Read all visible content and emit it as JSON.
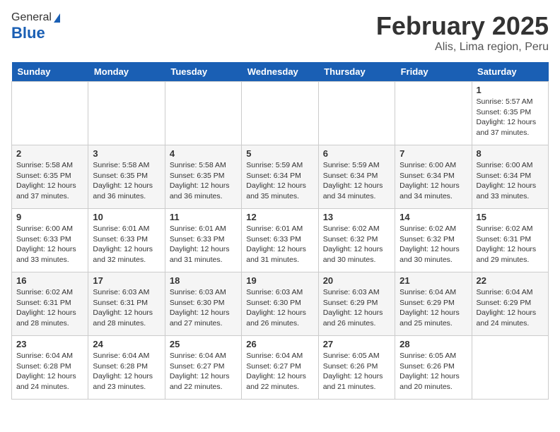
{
  "header": {
    "logo_general": "General",
    "logo_blue": "Blue",
    "title": "February 2025",
    "subtitle": "Alis, Lima region, Peru"
  },
  "days_of_week": [
    "Sunday",
    "Monday",
    "Tuesday",
    "Wednesday",
    "Thursday",
    "Friday",
    "Saturday"
  ],
  "weeks": [
    [
      {
        "day": "",
        "info": ""
      },
      {
        "day": "",
        "info": ""
      },
      {
        "day": "",
        "info": ""
      },
      {
        "day": "",
        "info": ""
      },
      {
        "day": "",
        "info": ""
      },
      {
        "day": "",
        "info": ""
      },
      {
        "day": "1",
        "info": "Sunrise: 5:57 AM\nSunset: 6:35 PM\nDaylight: 12 hours and 37 minutes."
      }
    ],
    [
      {
        "day": "2",
        "info": "Sunrise: 5:58 AM\nSunset: 6:35 PM\nDaylight: 12 hours and 37 minutes."
      },
      {
        "day": "3",
        "info": "Sunrise: 5:58 AM\nSunset: 6:35 PM\nDaylight: 12 hours and 36 minutes."
      },
      {
        "day": "4",
        "info": "Sunrise: 5:58 AM\nSunset: 6:35 PM\nDaylight: 12 hours and 36 minutes."
      },
      {
        "day": "5",
        "info": "Sunrise: 5:59 AM\nSunset: 6:34 PM\nDaylight: 12 hours and 35 minutes."
      },
      {
        "day": "6",
        "info": "Sunrise: 5:59 AM\nSunset: 6:34 PM\nDaylight: 12 hours and 34 minutes."
      },
      {
        "day": "7",
        "info": "Sunrise: 6:00 AM\nSunset: 6:34 PM\nDaylight: 12 hours and 34 minutes."
      },
      {
        "day": "8",
        "info": "Sunrise: 6:00 AM\nSunset: 6:34 PM\nDaylight: 12 hours and 33 minutes."
      }
    ],
    [
      {
        "day": "9",
        "info": "Sunrise: 6:00 AM\nSunset: 6:33 PM\nDaylight: 12 hours and 33 minutes."
      },
      {
        "day": "10",
        "info": "Sunrise: 6:01 AM\nSunset: 6:33 PM\nDaylight: 12 hours and 32 minutes."
      },
      {
        "day": "11",
        "info": "Sunrise: 6:01 AM\nSunset: 6:33 PM\nDaylight: 12 hours and 31 minutes."
      },
      {
        "day": "12",
        "info": "Sunrise: 6:01 AM\nSunset: 6:33 PM\nDaylight: 12 hours and 31 minutes."
      },
      {
        "day": "13",
        "info": "Sunrise: 6:02 AM\nSunset: 6:32 PM\nDaylight: 12 hours and 30 minutes."
      },
      {
        "day": "14",
        "info": "Sunrise: 6:02 AM\nSunset: 6:32 PM\nDaylight: 12 hours and 30 minutes."
      },
      {
        "day": "15",
        "info": "Sunrise: 6:02 AM\nSunset: 6:31 PM\nDaylight: 12 hours and 29 minutes."
      }
    ],
    [
      {
        "day": "16",
        "info": "Sunrise: 6:02 AM\nSunset: 6:31 PM\nDaylight: 12 hours and 28 minutes."
      },
      {
        "day": "17",
        "info": "Sunrise: 6:03 AM\nSunset: 6:31 PM\nDaylight: 12 hours and 28 minutes."
      },
      {
        "day": "18",
        "info": "Sunrise: 6:03 AM\nSunset: 6:30 PM\nDaylight: 12 hours and 27 minutes."
      },
      {
        "day": "19",
        "info": "Sunrise: 6:03 AM\nSunset: 6:30 PM\nDaylight: 12 hours and 26 minutes."
      },
      {
        "day": "20",
        "info": "Sunrise: 6:03 AM\nSunset: 6:29 PM\nDaylight: 12 hours and 26 minutes."
      },
      {
        "day": "21",
        "info": "Sunrise: 6:04 AM\nSunset: 6:29 PM\nDaylight: 12 hours and 25 minutes."
      },
      {
        "day": "22",
        "info": "Sunrise: 6:04 AM\nSunset: 6:29 PM\nDaylight: 12 hours and 24 minutes."
      }
    ],
    [
      {
        "day": "23",
        "info": "Sunrise: 6:04 AM\nSunset: 6:28 PM\nDaylight: 12 hours and 24 minutes."
      },
      {
        "day": "24",
        "info": "Sunrise: 6:04 AM\nSunset: 6:28 PM\nDaylight: 12 hours and 23 minutes."
      },
      {
        "day": "25",
        "info": "Sunrise: 6:04 AM\nSunset: 6:27 PM\nDaylight: 12 hours and 22 minutes."
      },
      {
        "day": "26",
        "info": "Sunrise: 6:04 AM\nSunset: 6:27 PM\nDaylight: 12 hours and 22 minutes."
      },
      {
        "day": "27",
        "info": "Sunrise: 6:05 AM\nSunset: 6:26 PM\nDaylight: 12 hours and 21 minutes."
      },
      {
        "day": "28",
        "info": "Sunrise: 6:05 AM\nSunset: 6:26 PM\nDaylight: 12 hours and 20 minutes."
      },
      {
        "day": "",
        "info": ""
      }
    ]
  ]
}
